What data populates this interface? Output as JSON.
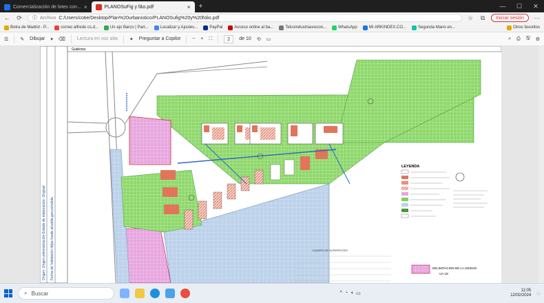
{
  "tabs": [
    {
      "label": "Comercialización de lotes con...",
      "active": false,
      "color": "#1a73e8"
    },
    {
      "label": "PLANOSuFig y f&o.pdf",
      "active": true,
      "color": "#d93025"
    }
  ],
  "address": {
    "prefix": "Archivo",
    "url": "C:/Users/cotie/Desktop/Plan%20urbanistico/PLANOSufig%20y%20folio.pdf",
    "signin": "Iniciar sesión"
  },
  "bookmarks": [
    "Botra de Madrid - P...",
    "correo alfredo cs.d...",
    "Un ajo Barco | Part...",
    "Localizar y Ajustes...",
    "PayPal",
    "Acceso online al ba...",
    "Telcoindustriasrecon...",
    "WhatsApp",
    "MI ARKINDEX.CO...",
    "Segunda Mano en...",
    "Otros favoritos"
  ],
  "pdf_toolbar": {
    "draw": "Dibujar",
    "read_aloud": "Lectura en voz alta",
    "copilot": "Preguntar a Copilot",
    "minus": "−",
    "plus": "+",
    "page_current": "2",
    "page_total": "de 10"
  },
  "document": {
    "vertical_note_1": "Origen: Origen administración   Estado de elaboración: Original",
    "vertical_note_2": "Fecha de Validación  https://sede.alcaldia.gov.co/valida",
    "header_cell": "Gutiérrez",
    "legend_title": "LEYENDA",
    "plan_label": "DELIMITACIÓN DE LA UNIDAD",
    "plan_sublabel": "UA-18",
    "table_title": "CUADRO DE SUPERFICIES"
  },
  "taskbar": {
    "search": "Buscar",
    "time": "11:05",
    "date": "12/02/2024"
  },
  "colors": {
    "green_zone": "#7bd45a",
    "water_zone": "#b9d0ea",
    "pink_zone": "#e9a3e0",
    "lot_orange": "#e2745a",
    "accent": "#0a64c8"
  }
}
